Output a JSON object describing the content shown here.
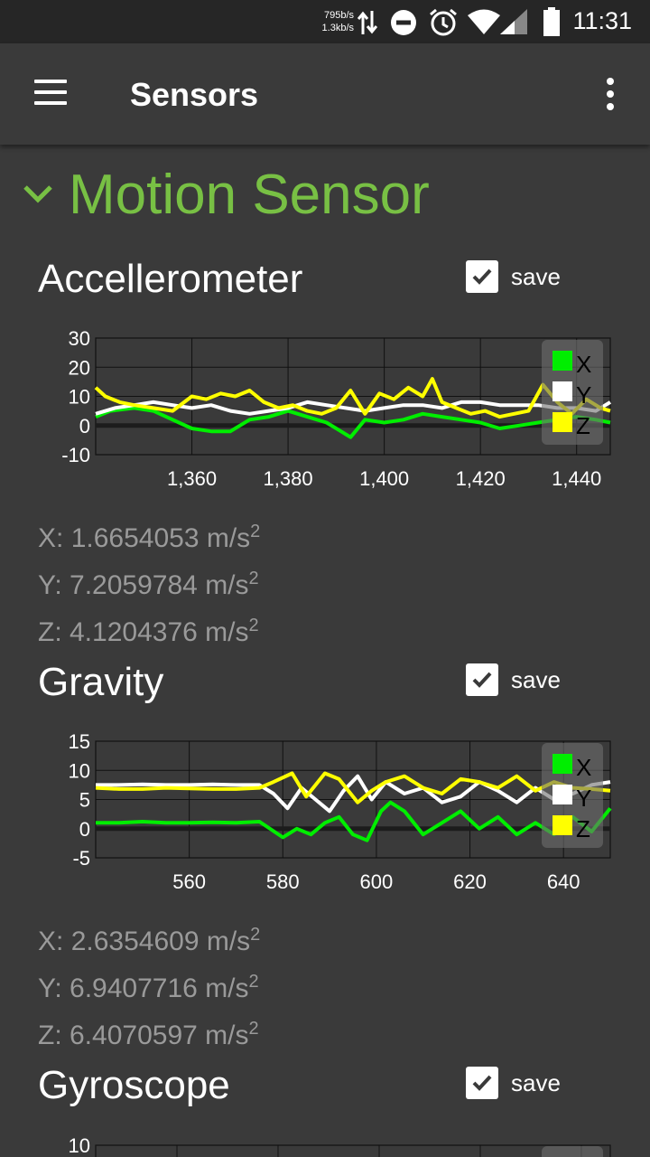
{
  "status_bar": {
    "net_up": "795b/s",
    "net_down": "1.3kb/s",
    "time": "11:31",
    "icons": [
      "data-transfer-icon",
      "do-not-disturb-icon",
      "alarm-icon",
      "wifi-icon",
      "cellular-signal-icon",
      "battery-icon"
    ]
  },
  "toolbar": {
    "title": "Sensors",
    "menu_icon": "hamburger-menu-icon",
    "more_icon": "more-vert-icon"
  },
  "section": {
    "title": "Motion Sensor",
    "icon": "chevron-down-icon",
    "accent": "#78c044"
  },
  "sensors": [
    {
      "title": "Accellerometer",
      "save_label": "save",
      "saved": true,
      "readouts": [
        {
          "axis": "X",
          "value": "1.6654053",
          "unit": "m/s",
          "exp": "2"
        },
        {
          "axis": "Y",
          "value": "7.2059784",
          "unit": "m/s",
          "exp": "2"
        },
        {
          "axis": "Z",
          "value": "4.1204376",
          "unit": "m/s",
          "exp": "2"
        }
      ]
    },
    {
      "title": "Gravity",
      "save_label": "save",
      "saved": true,
      "readouts": [
        {
          "axis": "X",
          "value": "2.6354609",
          "unit": "m/s",
          "exp": "2"
        },
        {
          "axis": "Y",
          "value": "6.9407716",
          "unit": "m/s",
          "exp": "2"
        },
        {
          "axis": "Z",
          "value": "6.4070597",
          "unit": "m/s",
          "exp": "2"
        }
      ]
    },
    {
      "title": "Gyroscope",
      "save_label": "save",
      "saved": true,
      "readouts": []
    }
  ],
  "chart_data": [
    {
      "type": "line",
      "ylim": [
        -10,
        30
      ],
      "yticks": [
        30,
        20,
        10,
        0,
        -10
      ],
      "xlim": [
        1340,
        1447
      ],
      "xticks": [
        1360,
        1380,
        1400,
        1420,
        1440
      ],
      "xtick_labels": [
        "1,360",
        "1,380",
        "1,400",
        "1,420",
        "1,440"
      ],
      "grid": true,
      "legend": "top-right",
      "series": [
        {
          "name": "X",
          "color": "#00ee00",
          "x": [
            1340,
            1343,
            1348,
            1352,
            1356,
            1360,
            1364,
            1368,
            1372,
            1376,
            1380,
            1384,
            1388,
            1391,
            1393,
            1396,
            1400,
            1404,
            1408,
            1412,
            1416,
            1420,
            1424,
            1428,
            1432,
            1436,
            1440,
            1444,
            1447
          ],
          "values": [
            3,
            5,
            6,
            5,
            2,
            -1,
            -2,
            -2,
            2,
            3,
            5,
            3,
            1,
            -2,
            -4,
            2,
            1,
            2,
            4,
            3,
            2,
            1,
            -1,
            0,
            1,
            2,
            3,
            2,
            1
          ]
        },
        {
          "name": "Y",
          "color": "#ffffff",
          "x": [
            1340,
            1344,
            1348,
            1352,
            1356,
            1360,
            1364,
            1368,
            1372,
            1376,
            1380,
            1384,
            1388,
            1392,
            1396,
            1400,
            1404,
            1408,
            1412,
            1416,
            1420,
            1424,
            1428,
            1432,
            1436,
            1440,
            1444,
            1447
          ],
          "values": [
            4,
            6,
            7,
            8,
            7,
            6,
            7,
            5,
            4,
            5,
            6,
            8,
            7,
            6,
            5,
            6,
            7,
            7,
            6,
            8,
            8,
            7,
            7,
            7,
            6,
            6,
            5,
            8
          ]
        },
        {
          "name": "Z",
          "color": "#ffff00",
          "x": [
            1340,
            1342,
            1345,
            1348,
            1352,
            1356,
            1360,
            1363,
            1366,
            1369,
            1372,
            1375,
            1378,
            1381,
            1384,
            1387,
            1390,
            1393,
            1396,
            1399,
            1402,
            1405,
            1408,
            1410,
            1412,
            1415,
            1418,
            1421,
            1424,
            1427,
            1430,
            1433,
            1436,
            1439,
            1442,
            1445,
            1447
          ],
          "values": [
            13,
            10,
            8,
            7,
            6,
            5,
            10,
            9,
            11,
            10,
            12,
            8,
            6,
            7,
            5,
            4,
            6,
            12,
            4,
            11,
            9,
            13,
            10,
            16,
            8,
            6,
            4,
            5,
            3,
            4,
            5,
            14,
            8,
            4,
            9,
            6,
            5
          ]
        }
      ]
    },
    {
      "type": "line",
      "ylim": [
        -5,
        15
      ],
      "yticks": [
        15,
        10,
        5,
        0,
        -5
      ],
      "xlim": [
        540,
        650
      ],
      "xticks": [
        560,
        580,
        600,
        620,
        640
      ],
      "xtick_labels": [
        "560",
        "580",
        "600",
        "620",
        "640"
      ],
      "grid": true,
      "legend": "top-right",
      "series": [
        {
          "name": "X",
          "color": "#00ee00",
          "x": [
            540,
            545,
            550,
            555,
            560,
            565,
            570,
            575,
            580,
            583,
            586,
            589,
            592,
            595,
            598,
            601,
            603,
            606,
            610,
            614,
            618,
            622,
            626,
            630,
            634,
            638,
            642,
            646,
            650
          ],
          "values": [
            1,
            1,
            1.2,
            1,
            1,
            1.1,
            1,
            1.2,
            -1.5,
            0,
            -1,
            1,
            2,
            -1,
            -2,
            3,
            4.5,
            3,
            -1,
            1,
            3,
            0,
            2,
            -1,
            1,
            -1,
            2,
            -0.5,
            3.5
          ]
        },
        {
          "name": "Y",
          "color": "#ffffff",
          "x": [
            540,
            545,
            550,
            555,
            560,
            565,
            570,
            575,
            578,
            581,
            584,
            587,
            590,
            593,
            596,
            599,
            602,
            606,
            610,
            614,
            618,
            622,
            626,
            630,
            634,
            638,
            642,
            646,
            650
          ],
          "values": [
            7.5,
            7.5,
            7.6,
            7.5,
            7.5,
            7.6,
            7.5,
            7.5,
            6,
            3.5,
            7,
            5,
            3,
            6.5,
            9,
            5,
            8,
            6,
            7,
            4.5,
            5.5,
            8,
            6.5,
            4.5,
            7,
            5,
            6,
            7.5,
            8
          ]
        },
        {
          "name": "Z",
          "color": "#ffff00",
          "x": [
            540,
            545,
            550,
            555,
            560,
            565,
            570,
            575,
            578,
            582,
            585,
            589,
            592,
            596,
            599,
            602,
            606,
            610,
            614,
            618,
            622,
            626,
            630,
            634,
            638,
            642,
            646,
            650
          ],
          "values": [
            7,
            6.8,
            6.8,
            7,
            6.9,
            6.8,
            6.8,
            7,
            8,
            9.5,
            5.5,
            9.5,
            8.5,
            4.5,
            6.5,
            8,
            9,
            7,
            6,
            8.5,
            8,
            7,
            9,
            6.5,
            8,
            7,
            6.8,
            6.5
          ]
        }
      ]
    },
    {
      "type": "line",
      "ylim": [
        -10,
        10
      ],
      "yticks": [
        10
      ],
      "grid": true,
      "legend": "top-right",
      "series": []
    }
  ]
}
